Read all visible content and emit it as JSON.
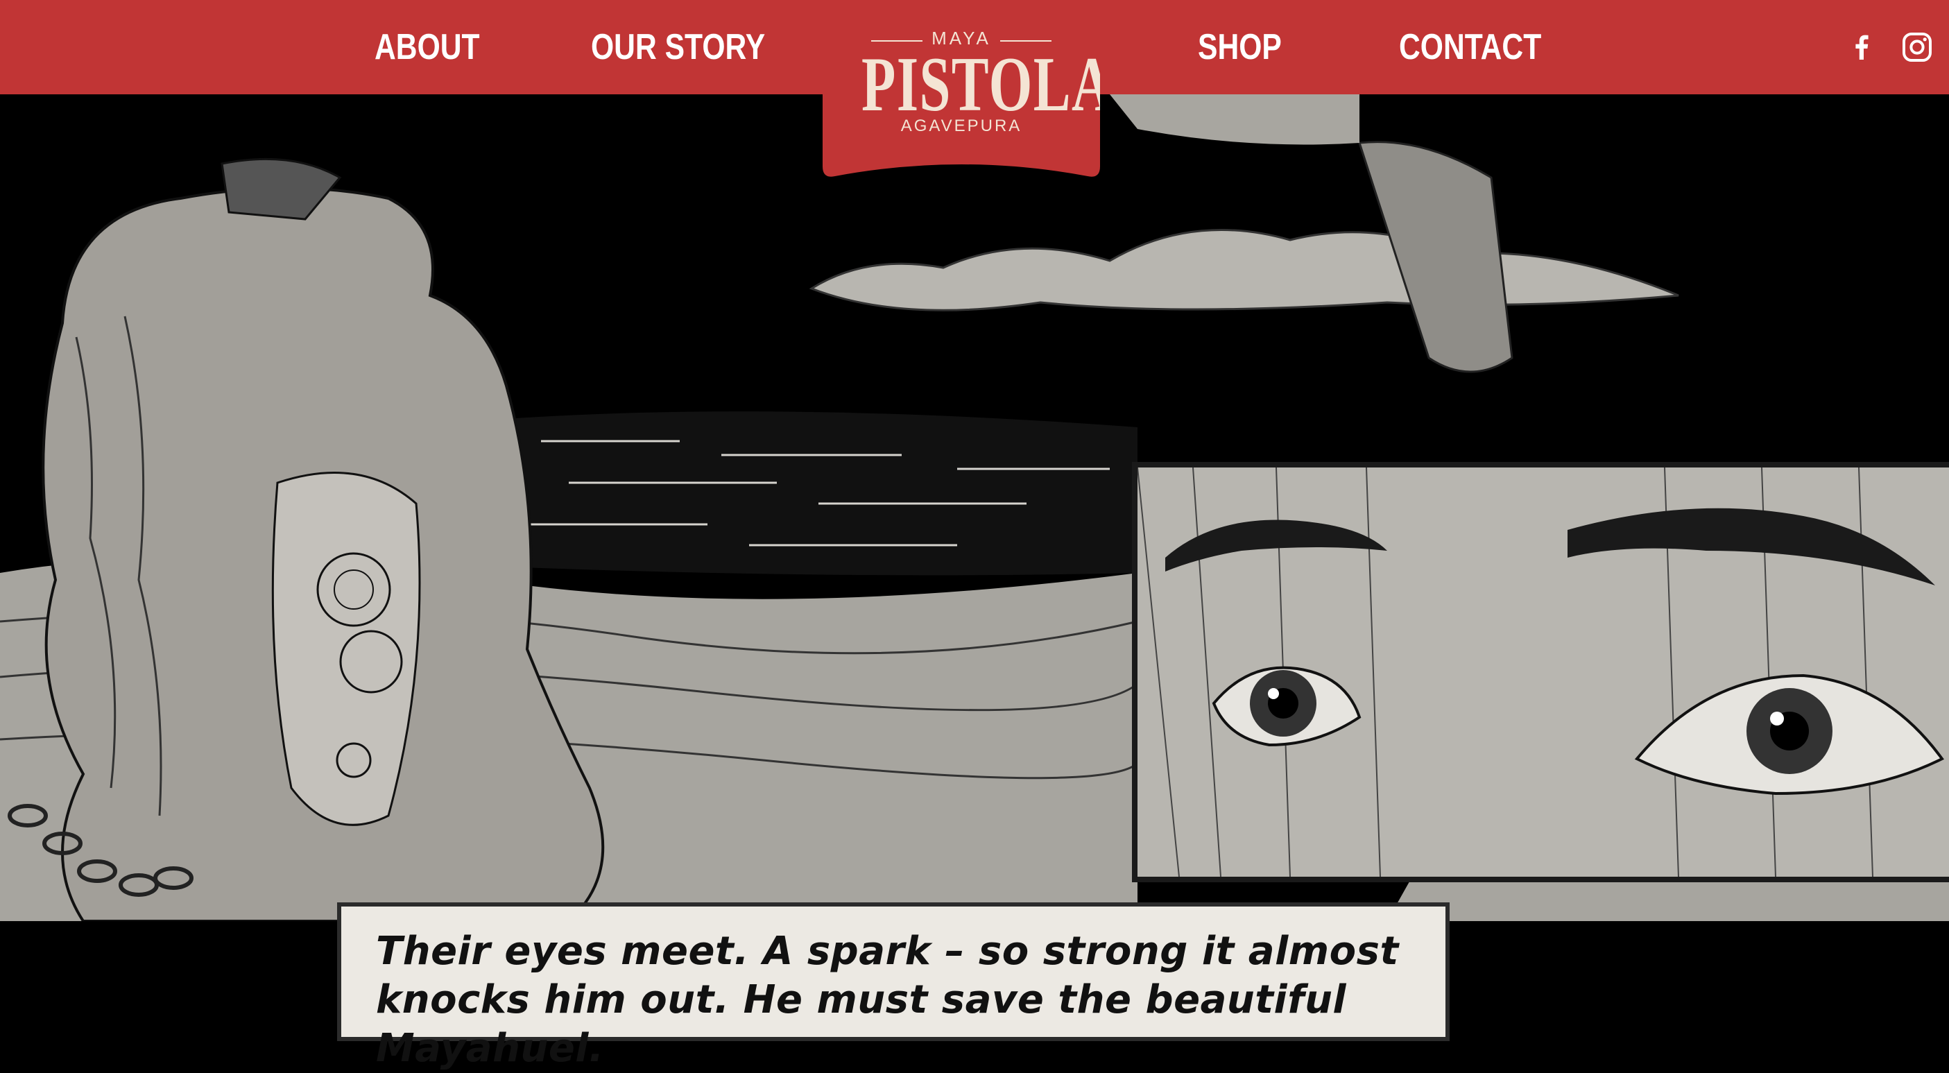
{
  "nav": {
    "about": "ABOUT",
    "our_story": "OUR STORY",
    "shop": "SHOP",
    "contact": "CONTACT"
  },
  "logo": {
    "top": "MAYA",
    "main": "PISTOLA",
    "sub": "AGAVEPURA"
  },
  "social": {
    "facebook_icon": "facebook-icon",
    "instagram_icon": "instagram-icon"
  },
  "caption": {
    "text": "Their eyes meet. A spark – so strong it almost knocks him out. He must save the beautiful Mayahuel."
  },
  "colors": {
    "brand_red": "#c13535",
    "logo_cream": "#f4e4d4",
    "illustration_gray": "#b8b6b0",
    "ink": "#111111"
  }
}
